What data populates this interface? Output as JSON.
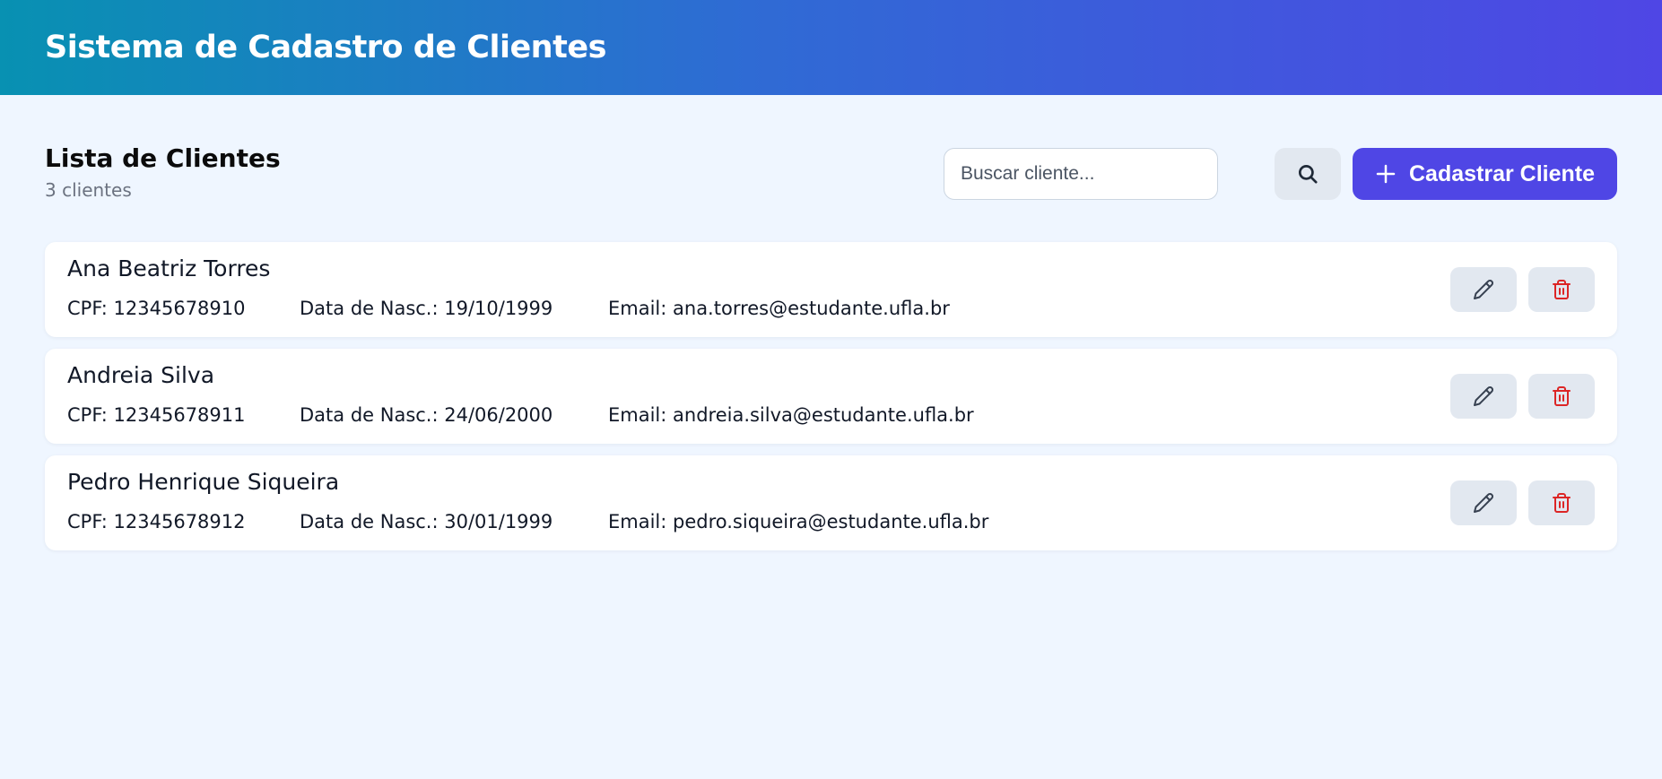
{
  "header": {
    "title": "Sistema de Cadastro de Clientes"
  },
  "list": {
    "title": "Lista de Clientes",
    "count": "3 clientes"
  },
  "search": {
    "placeholder": "Buscar cliente...",
    "value": ""
  },
  "toolbar": {
    "add_label": "Cadastrar Cliente"
  },
  "icons": {
    "search": "search-icon",
    "add": "plus-icon",
    "edit": "pencil-icon",
    "delete": "trash-icon"
  },
  "colors": {
    "header_start": "#0891b2",
    "header_end": "#4f46e5",
    "accent": "#4f46e5",
    "delete": "#dc2626",
    "background": "#eff6ff"
  },
  "clients": [
    {
      "name": "Ana Beatriz Torres",
      "cpf": "CPF: 12345678910",
      "birth": "Data de Nasc.: 19/10/1999",
      "email": "Email: ana.torres@estudante.ufla.br"
    },
    {
      "name": "Andreia Silva",
      "cpf": "CPF: 12345678911",
      "birth": "Data de Nasc.: 24/06/2000",
      "email": "Email: andreia.silva@estudante.ufla.br"
    },
    {
      "name": "Pedro Henrique Siqueira",
      "cpf": "CPF: 12345678912",
      "birth": "Data de Nasc.: 30/01/1999",
      "email": "Email: pedro.siqueira@estudante.ufla.br"
    }
  ]
}
